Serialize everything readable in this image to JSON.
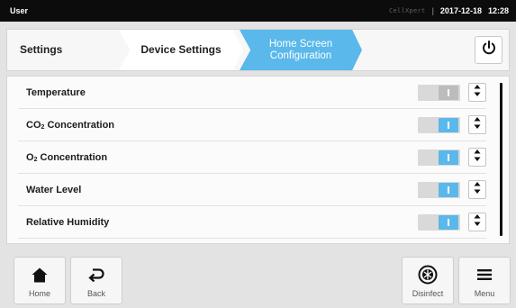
{
  "statusbar": {
    "user": "User",
    "brand": "CellXpert",
    "date": "2017-12-18",
    "time": "12:28"
  },
  "breadcrumb": {
    "items": [
      "Settings",
      "Device Settings",
      "Home Screen Configuration"
    ],
    "active_line1": "Home Screen",
    "active_line2": "Configuration"
  },
  "list": {
    "rows": [
      {
        "label": "Temperature",
        "toggle": "off"
      },
      {
        "label_main": "CO",
        "label_sub": "2",
        "label_rest": " Concentration",
        "toggle": "on"
      },
      {
        "label_main": "O",
        "label_sub": "2",
        "label_rest": " Concentration",
        "toggle": "on"
      },
      {
        "label": "Water Level",
        "toggle": "on"
      },
      {
        "label": "Relative Humidity",
        "toggle": "on"
      }
    ]
  },
  "nav": {
    "home": "Home",
    "back": "Back",
    "disinfect": "Disinfect",
    "menu": "Menu"
  },
  "colors": {
    "accent": "#5ab8ea",
    "statusbar": "#0c0c0c",
    "background": "#e3e3e3"
  },
  "icons": [
    "power-icon",
    "reorder-arrows-icon",
    "home-icon",
    "back-arrow-icon",
    "disinfect-icon",
    "menu-icon"
  ]
}
